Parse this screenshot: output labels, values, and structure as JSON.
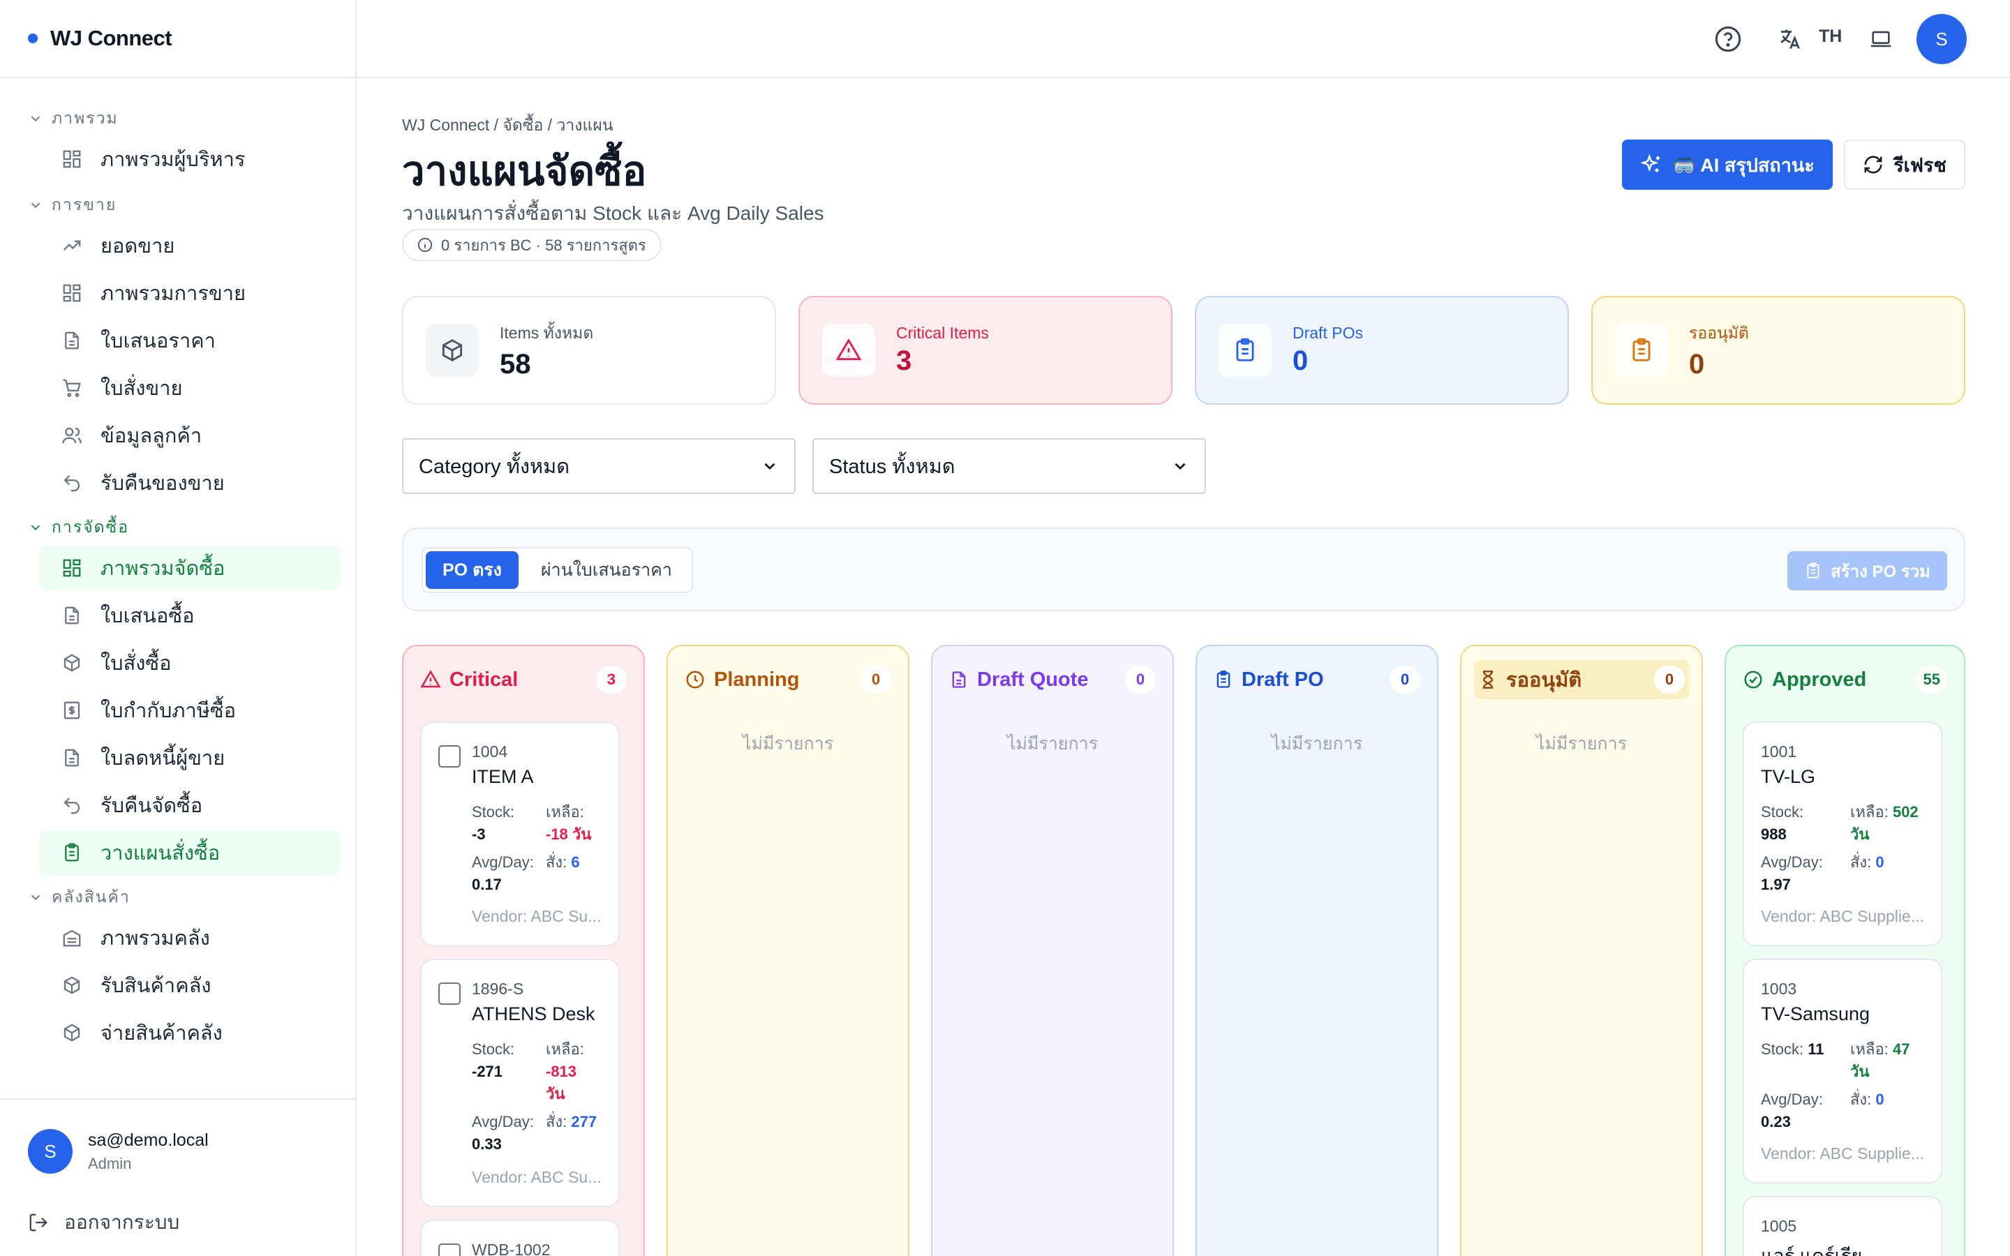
{
  "brand": {
    "name": "WJ Connect",
    "accent": "#2563eb"
  },
  "sidebar": {
    "groups": [
      {
        "label": "ภาพรวม",
        "items": [
          {
            "label": "ภาพรวมผู้บริหาร"
          }
        ]
      },
      {
        "label": "การขาย",
        "items": [
          {
            "label": "ยอดขาย"
          },
          {
            "label": "ภาพรวมการขาย"
          },
          {
            "label": "ใบเสนอราคา"
          },
          {
            "label": "ใบสั่งขาย"
          },
          {
            "label": "ข้อมูลลูกค้า"
          },
          {
            "label": "รับคืนของขาย"
          }
        ]
      },
      {
        "label": "การจัดซื้อ",
        "items": [
          {
            "label": "ภาพรวมจัดซื้อ"
          },
          {
            "label": "ใบเสนอซื้อ"
          },
          {
            "label": "ใบสั่งซื้อ"
          },
          {
            "label": "ใบกำกับภาษีซื้อ"
          },
          {
            "label": "ใบลดหนี้ผู้ขาย"
          },
          {
            "label": "รับคืนจัดซื้อ"
          },
          {
            "label": "วางแผนสั่งซื้อ"
          }
        ]
      },
      {
        "label": "คลังสินค้า",
        "items": [
          {
            "label": "ภาพรวมคลัง"
          },
          {
            "label": "รับสินค้าคลัง"
          },
          {
            "label": "จ่ายสินค้าคลัง"
          }
        ]
      }
    ],
    "user": {
      "initial": "S",
      "email": "sa@demo.local",
      "role": "Admin"
    },
    "logout_label": "ออกจากระบบ"
  },
  "topbar": {
    "lang": "TH",
    "avatar_initial": "S"
  },
  "header": {
    "breadcrumb": "WJ Connect / จัดซื้อ / วางแผน",
    "title": "วางแผนจัดซื้อ",
    "subtitle": "วางแผนการสั่งซื้อตาม Stock และ Avg Daily Sales",
    "info_chip": "0 รายการ BC · 58 รายการสูตร",
    "ai_button": "🥽 AI สรุปสถานะ",
    "refresh_button": "รีเฟรช"
  },
  "stats": [
    {
      "label": "Items ทั้งหมด",
      "value": "58"
    },
    {
      "label": "Critical Items",
      "value": "3"
    },
    {
      "label": "Draft POs",
      "value": "0"
    },
    {
      "label": "รออนุมัติ",
      "value": "0"
    }
  ],
  "filters": {
    "category": "Category ทั้งหมด",
    "status": "Status ทั้งหมด"
  },
  "toolbar": {
    "tab_direct": "PO ตรง",
    "tab_quote": "ผ่านใบเสนอราคา",
    "create_button": "สร้าง PO รวม"
  },
  "columns": {
    "critical": {
      "title": "Critical",
      "count": "3"
    },
    "planning": {
      "title": "Planning",
      "count": "0",
      "empty": "ไม่มีรายการ"
    },
    "draft_quote": {
      "title": "Draft Quote",
      "count": "0",
      "empty": "ไม่มีรายการ"
    },
    "draft_po": {
      "title": "Draft PO",
      "count": "0",
      "empty": "ไม่มีรายการ"
    },
    "waiting": {
      "title": "รออนุมัติ",
      "count": "0",
      "empty": "ไม่มีรายการ"
    },
    "approved": {
      "title": "Approved",
      "count": "55"
    }
  },
  "labels": {
    "stock": "Stock:",
    "remaining": "เหลือ:",
    "avg": "Avg/Day:",
    "order": "สั่ง:"
  },
  "critical_cards": [
    {
      "code": "1004",
      "name": "ITEM A",
      "stock": "-3",
      "remaining": "-18 วัน",
      "avg": "0.17",
      "order": "6",
      "vendor": "Vendor: ABC Su..."
    },
    {
      "code": "1896-S",
      "name": "ATHENS Desk",
      "stock": "-271",
      "remaining_1": "-813",
      "remaining_2": "วัน",
      "avg": "0.33",
      "order": "277",
      "vendor": "Vendor: ABC Su..."
    },
    {
      "code": "WDB-1002"
    }
  ],
  "approved_cards": [
    {
      "code": "1001",
      "name": "TV-LG",
      "stock": "988",
      "remaining_1": "502",
      "remaining_2": "วัน",
      "avg": "1.97",
      "order": "0",
      "vendor": "Vendor: ABC Supplie..."
    },
    {
      "code": "1003",
      "name": "TV-Samsung",
      "stock": "11",
      "remaining_1": "47",
      "remaining_2": "วัน",
      "avg": "0.23",
      "order": "0",
      "vendor": "Vendor: ABC Supplie..."
    },
    {
      "code": "1005",
      "name": "แอร์ แคร์เรีย"
    }
  ]
}
